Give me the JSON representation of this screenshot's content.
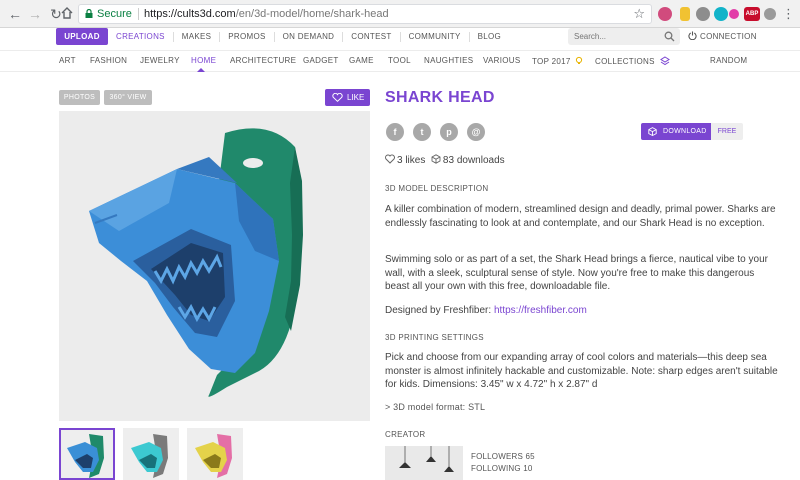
{
  "browser": {
    "secure_label": "Secure",
    "url_host": "https://cults3d.com",
    "url_path": "/en/3d-model/home/shark-head",
    "abp_label": "ABP"
  },
  "topbar": {
    "upload_label": "UPLOAD",
    "nav": [
      "CREATIONS",
      "MAKES",
      "PROMOS",
      "ON DEMAND",
      "CONTEST",
      "COMMUNITY",
      "BLOG"
    ],
    "search_placeholder": "Search...",
    "connection_label": "CONNECTION"
  },
  "categories": {
    "items": [
      "ART",
      "FASHION",
      "JEWELRY",
      "HOME",
      "ARCHITECTURE",
      "GADGET",
      "GAME",
      "TOOL",
      "NAUGHTIES",
      "VARIOUS",
      "TOP 2017",
      "COLLECTIONS",
      "RANDOM"
    ],
    "active": "HOME"
  },
  "gallery": {
    "photos_tab": "PHOTOS",
    "view360_tab": "360° VIEW",
    "like_label": "LIKE",
    "thumb_colors": [
      {
        "mount": "#1f8a6a",
        "head": "#3a8fd6"
      },
      {
        "mount": "#7a7a7a",
        "head": "#3cc9d1"
      },
      {
        "mount": "#e46fa6",
        "head": "#e4d24a"
      }
    ],
    "main_colors": {
      "mount": "#20896b",
      "head": "#3c8ed8",
      "background": "#ececec"
    }
  },
  "model": {
    "title": "SHARK HEAD",
    "social": [
      "f",
      "t",
      "p",
      "@"
    ],
    "download_label": "DOWNLOAD",
    "price_label": "FREE",
    "likes": "3 likes",
    "downloads": "83 downloads",
    "description_heading": "3D MODEL DESCRIPTION",
    "description_p1": "A killer combination of modern, streamlined design and deadly, primal power. Sharks are endlessly fascinating to look at and contemplate, and our Shark Head is no exception.",
    "description_p2": "Swimming solo or as part of a set, the Shark Head brings a fierce, nautical vibe to your wall, with a sleek, sculptural sense of style. Now you're free to make this dangerous beast all your own with this free, downloadable file.",
    "designed_by_prefix": "Designed by Freshfiber: ",
    "designed_by_link": "https://freshfiber.com",
    "printing_heading": "3D PRINTING SETTINGS",
    "printing_text": "Pick and choose from our expanding array of cool colors and materials—this deep sea monster is almost infinitely hackable and customizable. Note: sharp edges aren't suitable for kids. Dimensions: 3.45\" w x 4.72\" h x 2.87\" d",
    "format_line": ">  3D model format: STL",
    "creator_heading": "CREATOR",
    "followers": "FOLLOWERS 65",
    "following": "FOLLOWING 10"
  },
  "colors": {
    "accent": "#7a45d1",
    "secure": "#0b8043",
    "social": "#a8a8a8"
  }
}
